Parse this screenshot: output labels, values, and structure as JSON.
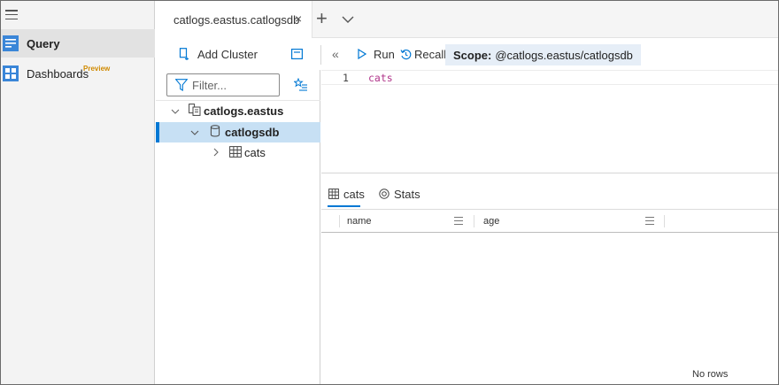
{
  "nav": {
    "items": [
      {
        "label": "Query",
        "icon": "query-icon",
        "active": true
      },
      {
        "label": "Dashboards",
        "icon": "dashboards-icon",
        "badge": "Preview"
      }
    ]
  },
  "tabs": {
    "items": [
      {
        "label": "catlogs.eastus.catlogsdb",
        "close": "×"
      }
    ],
    "add_label": "+"
  },
  "toolbar": {
    "add_cluster_label": "Add Cluster",
    "collapse_label": "«",
    "run_label": "Run",
    "recall_label": "Recall",
    "scope_label": "Scope:",
    "scope_value": "@catlogs.eastus/catlogsdb"
  },
  "tree": {
    "filter_placeholder": "Filter...",
    "cluster": "catlogs.eastus",
    "database": "catlogsdb",
    "table": "cats"
  },
  "editor": {
    "line_number": "1",
    "code": "cats"
  },
  "results": {
    "tabs": [
      {
        "label": "cats"
      },
      {
        "label": "Stats"
      }
    ],
    "columns": [
      "name",
      "age"
    ],
    "empty_text": "No rows"
  },
  "colors": {
    "accent": "#0078d4",
    "selected_row": "#c7e0f4",
    "scope_bg": "#e6eef7",
    "keyword": "#b0358a",
    "preview_badge": "#d08a00"
  }
}
